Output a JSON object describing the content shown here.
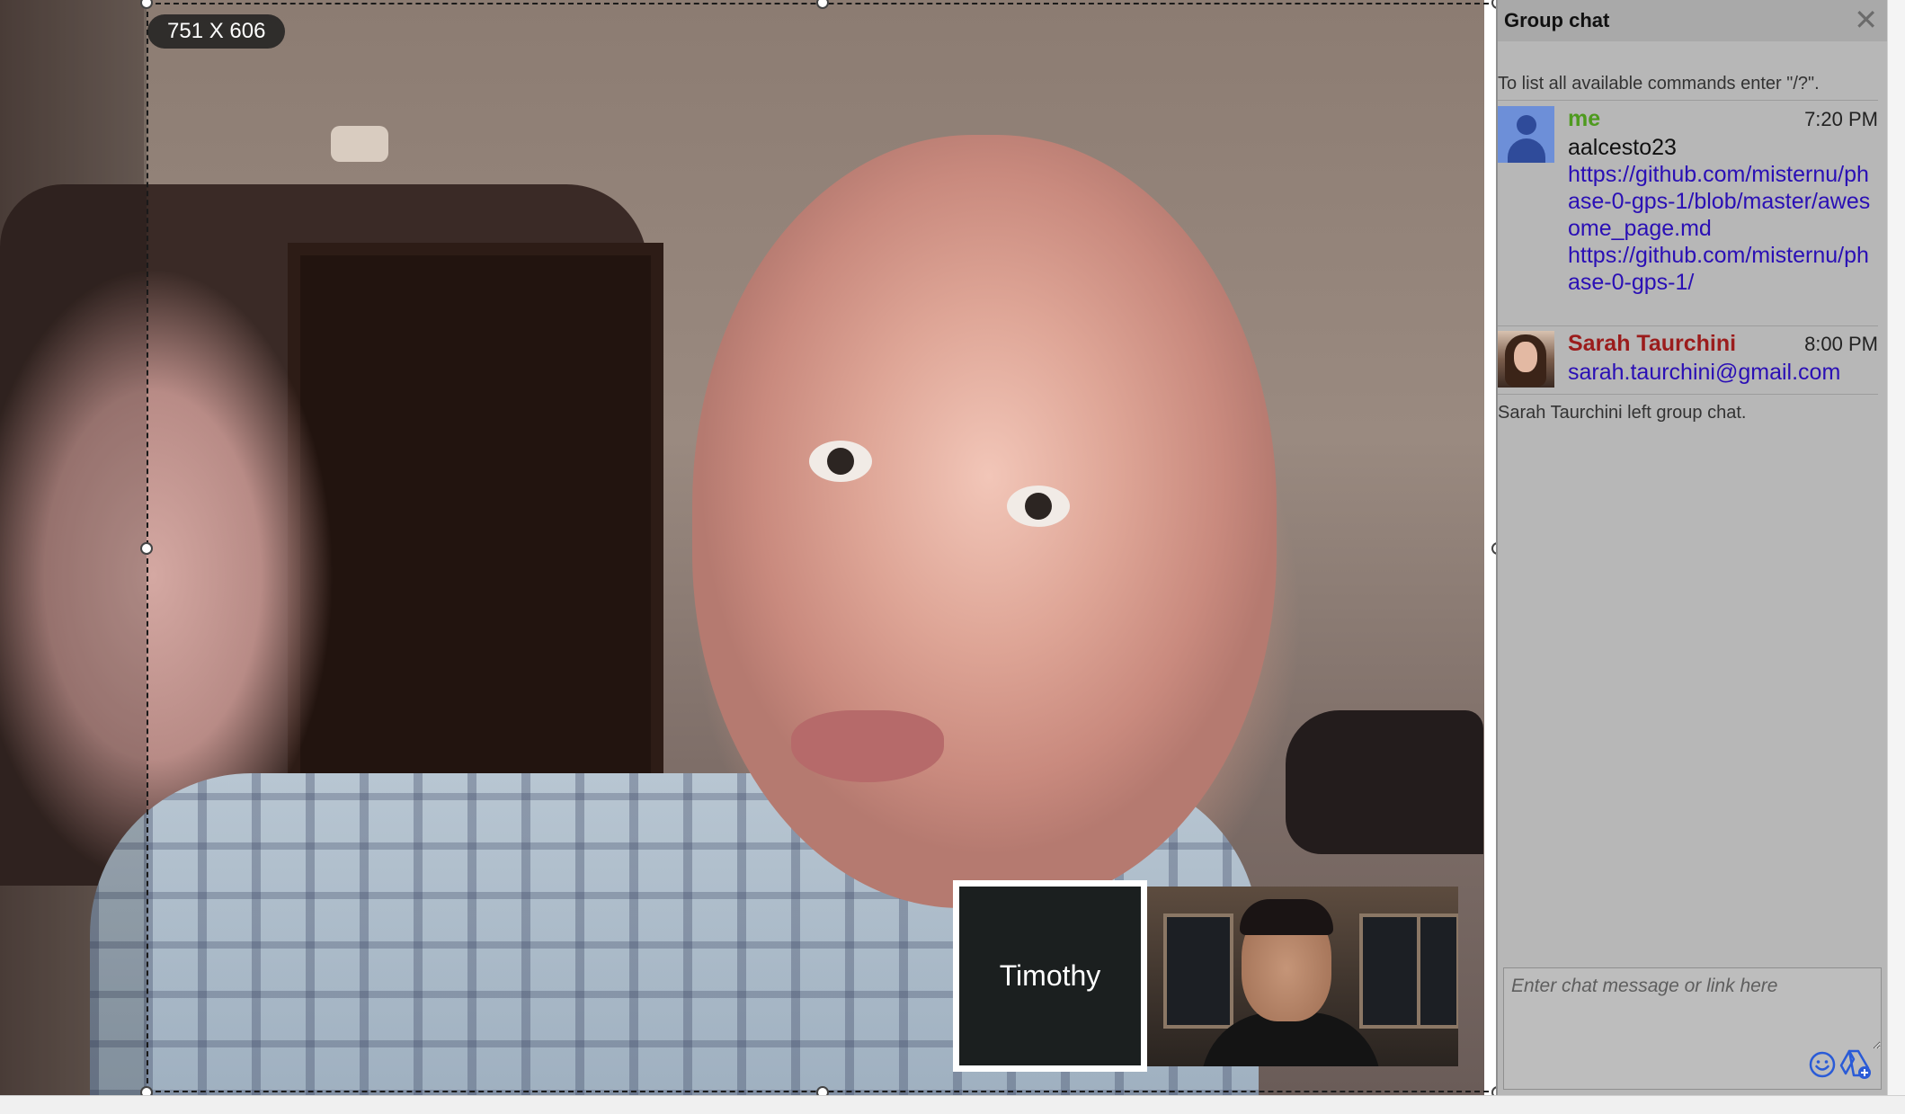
{
  "crop_overlay": {
    "size_label": "751 X 606"
  },
  "self_view": {
    "name": "Timothy"
  },
  "chat": {
    "title": "Group chat",
    "close_icon": "close-icon",
    "hint": "To list all available commands enter \"/?\".",
    "messages": [
      {
        "sender": "me",
        "sender_color": "#4e9a1e",
        "time": "7:20 PM",
        "avatar": "default-person-avatar",
        "lines": [
          {
            "type": "text",
            "text": "aalcesto23"
          },
          {
            "type": "link",
            "text": "https://github.com/misternu/phase-0-gps-1/blob/master/awesome_page.md"
          },
          {
            "type": "link",
            "text": "https://github.com/misternu/phase-0-gps-1/"
          }
        ]
      },
      {
        "sender": "Sarah Taurchini",
        "sender_color": "#9b1c1c",
        "time": "8:00 PM",
        "avatar": "photo-avatar",
        "lines": [
          {
            "type": "link",
            "text": "sarah.taurchini@gmail.com"
          }
        ]
      }
    ],
    "system_message": "Sarah Taurchini left group chat.",
    "input": {
      "placeholder": "Enter chat message or link here",
      "value": ""
    },
    "emoji_icon": "smiley-icon",
    "drive_icon": "google-drive-add-icon"
  },
  "colors": {
    "link": "#2a0fb5",
    "panel_bg": "#b7b7b7",
    "me_color": "#4e9a1e",
    "other_color": "#9b1c1c"
  }
}
